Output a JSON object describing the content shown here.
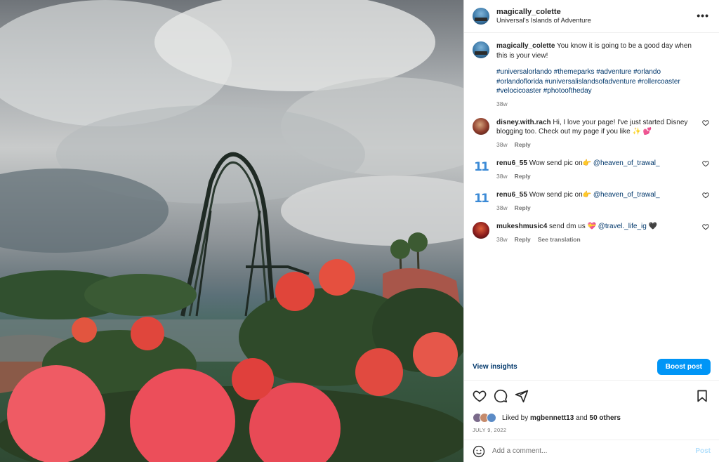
{
  "post": {
    "username": "magically_colette",
    "location": "Universal's Islands of Adventure",
    "more_icon": "more-options-icon"
  },
  "caption": {
    "username": "magically_colette",
    "text": "You know it is going to be a good day when this is your view!",
    "hashtags": "#universalorlando #themeparks #adventure #orlando #orlandoflorida #universalislandsofadventure #rollercoaster #velocicoaster #photooftheday",
    "time": "38w"
  },
  "comments": [
    {
      "username": "disney.with.rach",
      "text": "Hi, I love your page! I've just started Disney blogging too. Check out my page if you like ✨ 💕",
      "time": "38w",
      "reply": "Reply"
    },
    {
      "username": "renu6_55",
      "text": "Wow send pic on👉 ",
      "mention": "@heaven_of_trawal_",
      "time": "38w",
      "reply": "Reply"
    },
    {
      "username": "renu6_55",
      "text": "Wow send pic on👉 ",
      "mention": "@heaven_of_trawal_",
      "time": "38w",
      "reply": "Reply"
    },
    {
      "username": "mukeshmusic4",
      "text": "send dm us  💝 ",
      "mention": "@travel._life_ig",
      "suffix": " 🖤",
      "time": "38w",
      "reply": "Reply",
      "translate": "See translation"
    }
  ],
  "insights": {
    "view_label": "View insights",
    "boost_label": "Boost post",
    "boost_color": "#0095f6"
  },
  "likes": {
    "prefix": "Liked by",
    "user": "mgbennett13",
    "and": "and",
    "others": "50 others"
  },
  "date": "JULY 9, 2022",
  "add_comment": {
    "placeholder": "Add a comment...",
    "post_label": "Post"
  },
  "renu_avatar_text": "11"
}
